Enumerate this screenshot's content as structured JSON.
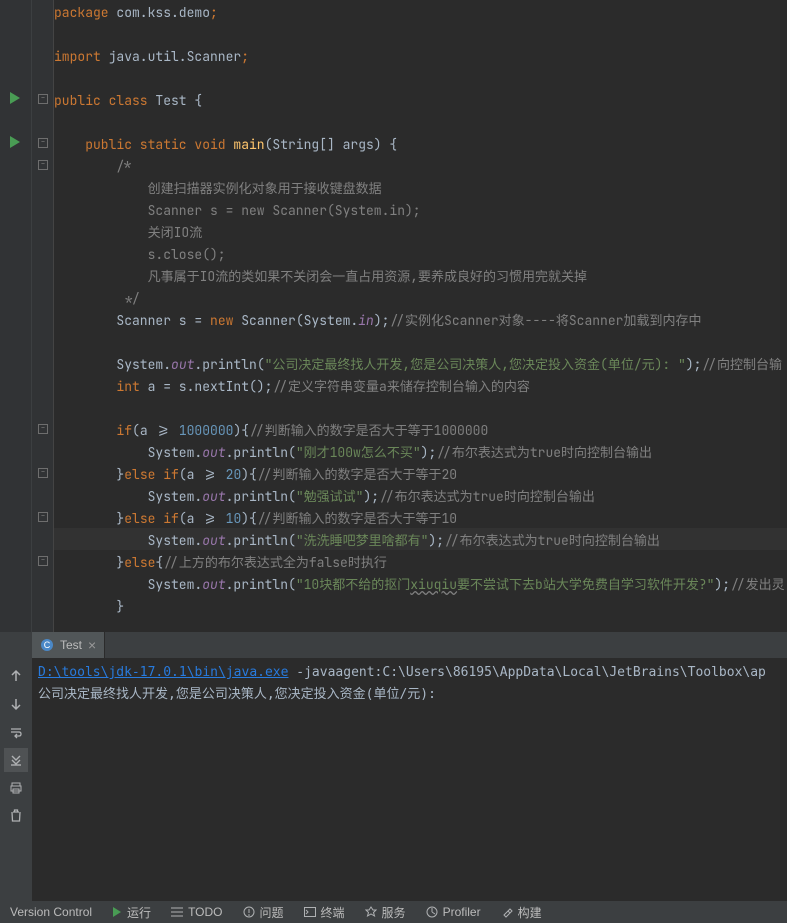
{
  "code": {
    "l1": {
      "kw1": "package ",
      "pkg": "com.kss.demo",
      "semi": ";"
    },
    "l3": {
      "kw": "import ",
      "pkg": "java.util.Scanner",
      "semi": ";"
    },
    "l5": {
      "kw": "public class ",
      "name": "Test ",
      "brace": "{"
    },
    "l7": {
      "pad": "    ",
      "kw": "public static void ",
      "method": "main",
      "sig": "(String[] args) ",
      "brace": "{"
    },
    "l8": "        /*",
    "l9": "            创建扫描器实例化对象用于接收键盘数据",
    "l10": "            Scanner s = new Scanner(System.in);",
    "l11": "            关闭IO流",
    "l12": "            s.close();",
    "l13": "            凡事属于IO流的类如果不关闭会一直占用资源,要养成良好的习惯用完就关掉",
    "l14": "         */",
    "l15": {
      "pad": "        ",
      "t1": "Scanner s = ",
      "kw": "new ",
      "t2": "Scanner(System.",
      "field": "in",
      "t3": ");",
      "cmt": "//实例化Scanner对象----将Scanner加载到内存中"
    },
    "l17": {
      "pad": "        ",
      "t1": "System.",
      "field": "out",
      "t2": ".println(",
      "str": "\"公司决定最终找人开发,您是公司决策人,您决定投入资金(单位/元): \"",
      "t3": ");",
      "cmt": "//向控制台输"
    },
    "l18": {
      "pad": "        ",
      "kw": "int ",
      "t1": "a = s.nextInt();",
      "cmt": "//定义字符串变量a来储存控制台输入的内容"
    },
    "l20": {
      "pad": "        ",
      "kw": "if",
      "t1": "(a >= ",
      "num": "1000000",
      "t2": "){",
      "cmt": "//判断输入的数字是否大于等于1000000"
    },
    "l21": {
      "pad": "            ",
      "t1": "System.",
      "field": "out",
      "t2": ".println(",
      "str": "\"刚才100w怎么不买\"",
      "t3": ");",
      "cmt": "//布尔表达式为true时向控制台输出"
    },
    "l22": {
      "pad": "        ",
      "t1": "}",
      "kw": "else if",
      "t2": "(a >= ",
      "num": "20",
      "t3": "){",
      "cmt": "//判断输入的数字是否大于等于20"
    },
    "l23": {
      "pad": "            ",
      "t1": "System.",
      "field": "out",
      "t2": ".println(",
      "str": "\"勉强试试\"",
      "t3": ");",
      "cmt": "//布尔表达式为true时向控制台输出"
    },
    "l24": {
      "pad": "        ",
      "t1": "}",
      "kw": "else if",
      "t2": "(a >= ",
      "num": "10",
      "t3": "){",
      "cmt": "//判断输入的数字是否大于等于10"
    },
    "l25": {
      "pad": "            ",
      "t1": "System.",
      "field": "out",
      "t2": ".println(",
      "str": "\"洗洗睡吧梦里啥都有\"",
      "t3": ");",
      "cmt": "//布尔表达式为true时向控制台输出"
    },
    "l26": {
      "pad": "        ",
      "t1": "}",
      "kw": "else",
      "t2": "{",
      "cmt": "//上方的布尔表达式全为false时执行"
    },
    "l27": {
      "pad": "            ",
      "t1": "System.",
      "field": "out",
      "t2": ".println(",
      "str1": "\"10块都不给的抠门",
      "uw": "xiuqiu",
      "str2": "要不尝试下去b站大学免费自学习软件开发?\"",
      "t3": ");",
      "cmt": "//发出灵"
    },
    "l28": "        }"
  },
  "tab": {
    "name": "Test",
    "close": "×"
  },
  "console": {
    "path": "D:\\tools\\jdk-17.0.1\\bin\\java.exe",
    "args": " -javaagent:C:\\Users\\86195\\AppData\\Local\\JetBrains\\Toolbox\\ap",
    "line2": "公司决定最终找人开发,您是公司决策人,您决定投入资金(单位/元): "
  },
  "bottom": {
    "vc": "Version Control",
    "run": "运行",
    "todo": "TODO",
    "problems": "问题",
    "terminal": "终端",
    "services": "服务",
    "profiler": "Profiler",
    "build": "构建"
  }
}
